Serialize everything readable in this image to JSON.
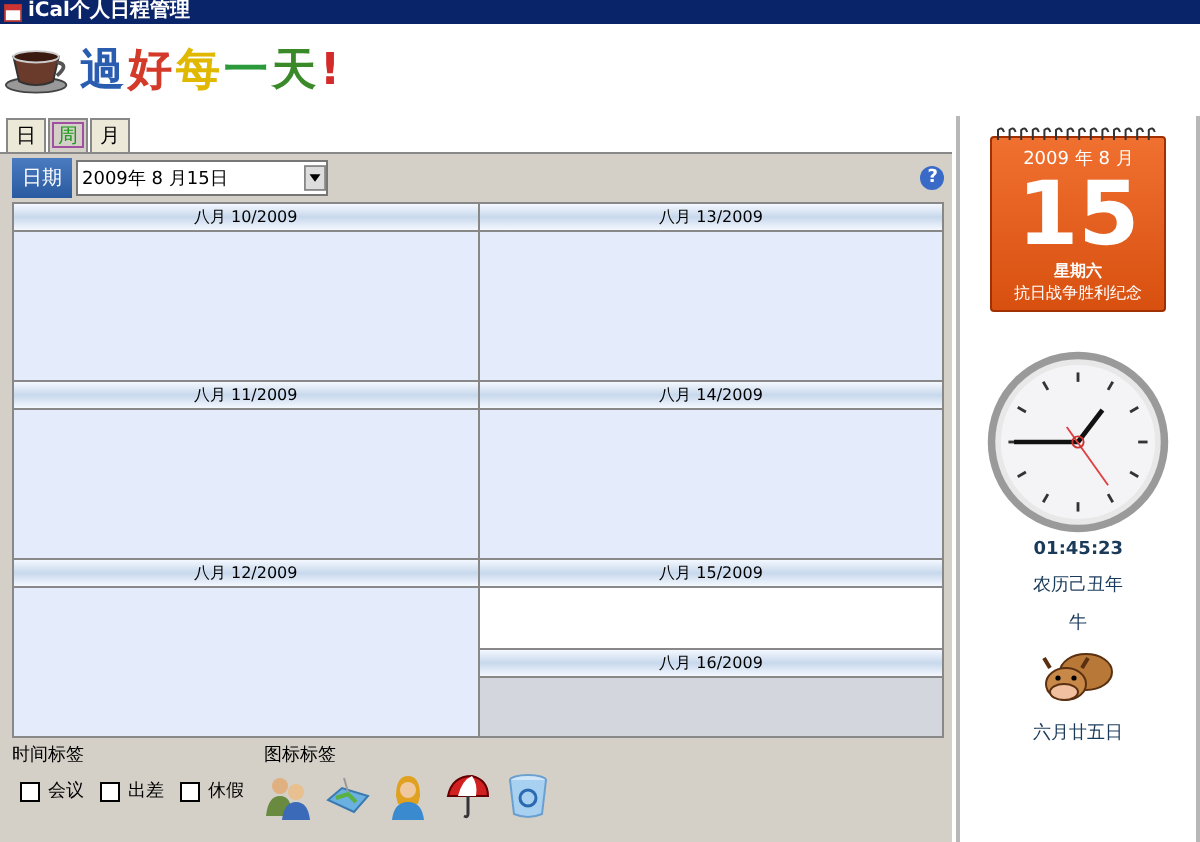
{
  "window": {
    "title": "iCal个人日程管理"
  },
  "logo": {
    "text": "過好每一天!"
  },
  "tabs": [
    {
      "label": "日",
      "selected": false
    },
    {
      "label": "周",
      "selected": true
    },
    {
      "label": "月",
      "selected": false
    }
  ],
  "date_bar": {
    "label": "日期",
    "value": "2009年 8 月15日",
    "help": "?"
  },
  "days": [
    {
      "header": "八月 10/2009",
      "kind": "weekday"
    },
    {
      "header": "八月 11/2009",
      "kind": "weekday"
    },
    {
      "header": "八月 12/2009",
      "kind": "weekday"
    },
    {
      "header": "八月 13/2009",
      "kind": "weekday"
    },
    {
      "header": "八月 14/2009",
      "kind": "weekday"
    },
    {
      "header": "八月 15/2009",
      "kind": "today"
    },
    {
      "header": "八月 16/2009",
      "kind": "weekend"
    }
  ],
  "time_tags": {
    "title": "时间标签",
    "items": [
      {
        "label": "会议",
        "checked": false
      },
      {
        "label": "出差",
        "checked": false
      },
      {
        "label": "休假",
        "checked": false
      }
    ]
  },
  "icon_tags": {
    "title": "图标标签"
  },
  "sidebar": {
    "calendar": {
      "year_month": "2009 年 8 月",
      "day": "15",
      "weekday": "星期六",
      "holiday": "抗日战争胜利纪念"
    },
    "time": "01:45:23",
    "lunar_year": "农历己丑年",
    "zodiac": "牛",
    "lunar_date": "六月廿五日"
  }
}
